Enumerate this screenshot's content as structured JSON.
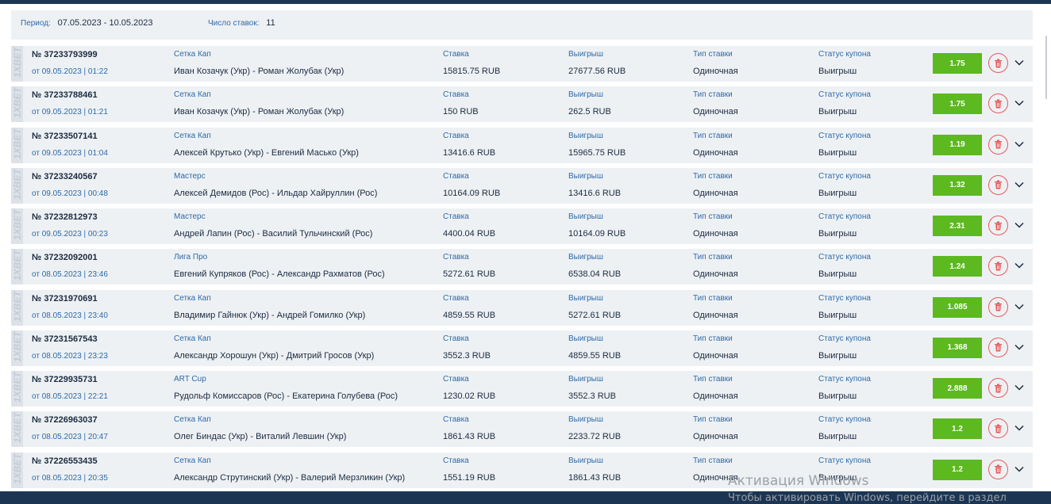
{
  "summary": {
    "period_label": "Период:",
    "period_value": "07.05.2023 - 10.05.2023",
    "count_label": "Число ставок:",
    "count_value": "11"
  },
  "columns": {
    "stake_label": "Ставка",
    "win_label": "Выигрыш",
    "type_label": "Тип ставки",
    "status_label": "Статус купона"
  },
  "logo_text": "1XBET",
  "bets": [
    {
      "number": "№ 37233793999",
      "date": "от 09.05.2023 | 01:22",
      "tournament": "Сетка Кап",
      "match": "Иван Козачук (Укр) - Роман Жолубак (Укр)",
      "stake": "15815.75 RUB",
      "win": "27677.56 RUB",
      "type": "Одиночная",
      "status": "Выигрыш",
      "coef": "1.75"
    },
    {
      "number": "№ 37233788461",
      "date": "от 09.05.2023 | 01:21",
      "tournament": "Сетка Кап",
      "match": "Иван Козачук (Укр) - Роман Жолубак (Укр)",
      "stake": "150 RUB",
      "win": "262.5 RUB",
      "type": "Одиночная",
      "status": "Выигрыш",
      "coef": "1.75"
    },
    {
      "number": "№ 37233507141",
      "date": "от 09.05.2023 | 01:04",
      "tournament": "Сетка Кап",
      "match": "Алексей Крутько (Укр) - Евгений Масько (Укр)",
      "stake": "13416.6 RUB",
      "win": "15965.75 RUB",
      "type": "Одиночная",
      "status": "Выигрыш",
      "coef": "1.19"
    },
    {
      "number": "№ 37233240567",
      "date": "от 09.05.2023 | 00:48",
      "tournament": "Мастерс",
      "match": "Алексей Демидов (Рос) - Ильдар Хайруллин (Рос)",
      "stake": "10164.09 RUB",
      "win": "13416.6 RUB",
      "type": "Одиночная",
      "status": "Выигрыш",
      "coef": "1.32"
    },
    {
      "number": "№ 37232812973",
      "date": "от 09.05.2023 | 00:23",
      "tournament": "Мастерс",
      "match": "Андрей Лапин (Рос) - Василий Тульчинский (Рос)",
      "stake": "4400.04 RUB",
      "win": "10164.09 RUB",
      "type": "Одиночная",
      "status": "Выигрыш",
      "coef": "2.31"
    },
    {
      "number": "№ 37232092001",
      "date": "от 08.05.2023 | 23:46",
      "tournament": "Лига Про",
      "match": "Евгений Купряков (Рос) - Александр Рахматов (Рос)",
      "stake": "5272.61 RUB",
      "win": "6538.04 RUB",
      "type": "Одиночная",
      "status": "Выигрыш",
      "coef": "1.24"
    },
    {
      "number": "№ 37231970691",
      "date": "от 08.05.2023 | 23:40",
      "tournament": "Сетка Кап",
      "match": "Владимир Гайнюк (Укр) - Андрей Гомилко (Укр)",
      "stake": "4859.55 RUB",
      "win": "5272.61 RUB",
      "type": "Одиночная",
      "status": "Выигрыш",
      "coef": "1.085"
    },
    {
      "number": "№ 37231567543",
      "date": "от 08.05.2023 | 23:23",
      "tournament": "Сетка Кап",
      "match": "Александр Хорошун (Укр) - Дмитрий Гросов (Укр)",
      "stake": "3552.3 RUB",
      "win": "4859.55 RUB",
      "type": "Одиночная",
      "status": "Выигрыш",
      "coef": "1.368"
    },
    {
      "number": "№ 37229935731",
      "date": "от 08.05.2023 | 22:21",
      "tournament": "ART Cup",
      "match": "Рудольф Комиссаров (Рос) - Екатерина Голубева (Рос)",
      "stake": "1230.02 RUB",
      "win": "3552.3 RUB",
      "type": "Одиночная",
      "status": "Выигрыш",
      "coef": "2.888"
    },
    {
      "number": "№ 37226963037",
      "date": "от 08.05.2023 | 20:47",
      "tournament": "Сетка Кап",
      "match": "Олег Биндас (Укр) - Виталий Левшин (Укр)",
      "stake": "1861.43 RUB",
      "win": "2233.72 RUB",
      "type": "Одиночная",
      "status": "Выигрыш",
      "coef": "1.2"
    },
    {
      "number": "№ 37226553435",
      "date": "от 08.05.2023 | 20:35",
      "tournament": "Сетка Кап",
      "match": "Александр Струтинский (Укр) - Валерий Мерзликин (Укр)",
      "stake": "1551.19 RUB",
      "win": "1861.43 RUB",
      "type": "Одиночная",
      "status": "Выигрыш",
      "coef": "1.2"
    }
  ],
  "icons": {
    "delete": "trash-icon",
    "expand": "chevron-down-icon"
  },
  "colors": {
    "coef_bg": "#5cb91f",
    "delete_border": "#e65a5a",
    "accent_text": "#2d6aa8",
    "frame": "#1c3553"
  },
  "watermark": {
    "line1": "Активация Windows",
    "line2": "Чтобы активировать Windows, перейдите в раздел"
  }
}
